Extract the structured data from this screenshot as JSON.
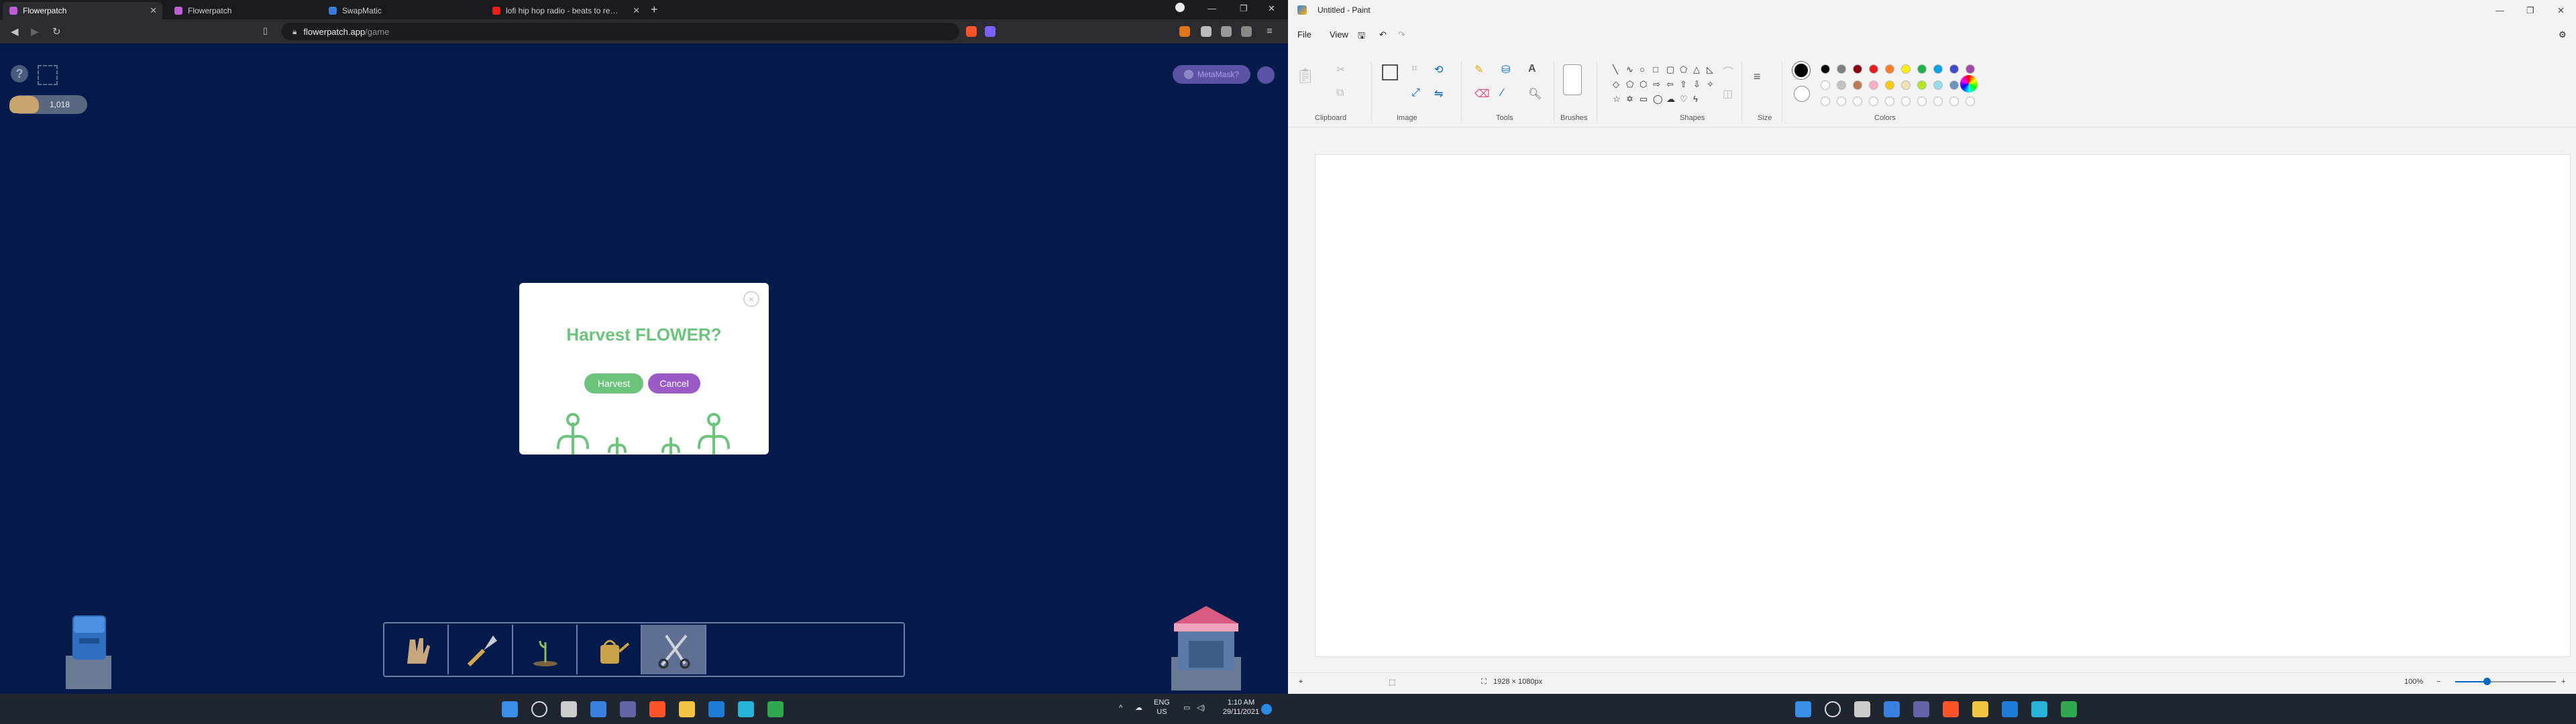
{
  "browser": {
    "tabs": [
      {
        "label": "Flowerpatch",
        "active": true
      },
      {
        "label": "Flowerpatch",
        "active": false
      },
      {
        "label": "SwapMatic",
        "active": false
      },
      {
        "label": "lofi hip hop radio - beats to relax/study to",
        "active": false
      }
    ],
    "new_tab": "+",
    "url_host": "flowerpatch.app",
    "url_path": "/game"
  },
  "game": {
    "help": "?",
    "coins": "1,018",
    "connect_label": "MetaMask?",
    "dialog": {
      "title": "Harvest FLOWER?",
      "harvest_label": "Harvest",
      "cancel_label": "Cancel",
      "close": "×"
    },
    "tools": [
      "gloves-icon",
      "trowel-icon",
      "seed-icon",
      "watering-can-icon",
      "shears-icon"
    ],
    "selected_tool": 4
  },
  "taskbar": {
    "lang_top": "ENG",
    "lang_bottom": "US",
    "time": "1:10 AM",
    "date": "29/11/2021"
  },
  "paint": {
    "title": "Untitled - Paint",
    "menu": [
      "File",
      "View"
    ],
    "groups": [
      "Clipboard",
      "Image",
      "Tools",
      "Brushes",
      "Shapes",
      "Size",
      "Colors"
    ],
    "palette_row1": [
      "#000000",
      "#7f7f7f",
      "#880015",
      "#ed1c24",
      "#ff7f27",
      "#fff200",
      "#22b14c",
      "#00a2e8",
      "#3f48cc",
      "#a349a4"
    ],
    "palette_row2": [
      "#ffffff",
      "#c3c3c3",
      "#b97a57",
      "#ffaec9",
      "#ffc90e",
      "#efe4b0",
      "#b5e61d",
      "#99d9ea",
      "#7092be",
      "#c8bfe7"
    ],
    "canvas_size": "1928 × 1080px",
    "zoom": "100%"
  }
}
